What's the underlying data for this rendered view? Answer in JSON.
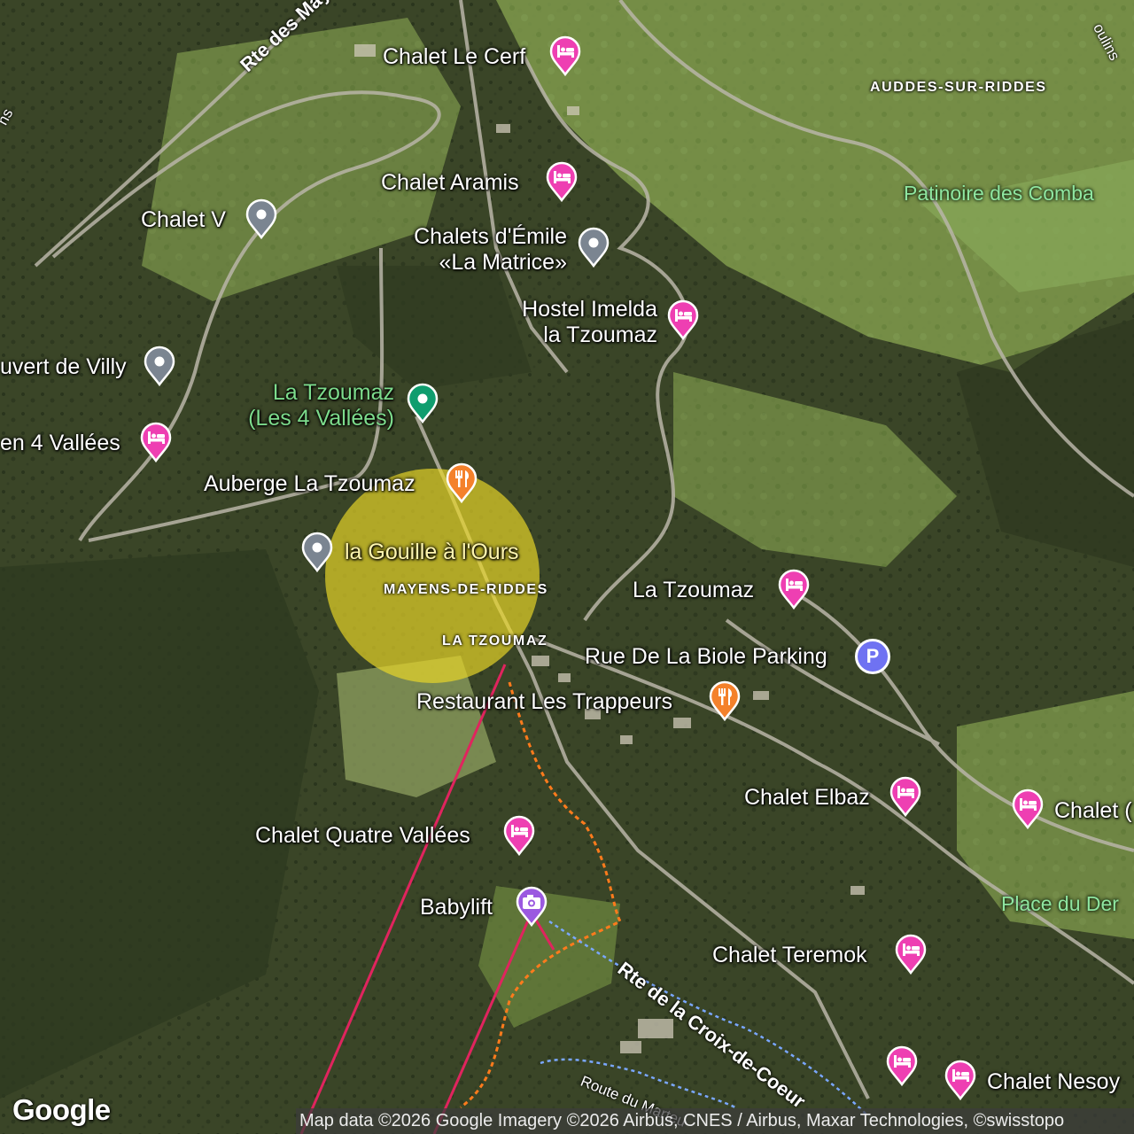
{
  "map": {
    "area_labels": [
      "AUDDES-SUR-RIDDES",
      "MAYENS-DE-RIDDES",
      "LA TZOUMAZ"
    ],
    "poi_labels": [
      "Patinoire des Comba",
      "Place du Der"
    ],
    "roads": [
      "Rte des Maye",
      "Rte de la Croix-de-Coeur",
      "Route du Marteu",
      "oulins",
      "ns"
    ],
    "markers": [
      {
        "label": "Chalet Le Cerf",
        "type": "lodging",
        "icon": "bed-icon",
        "color": "#ee3fb2"
      },
      {
        "label": "Chalet Aramis",
        "type": "lodging",
        "icon": "bed-icon",
        "color": "#ee3fb2"
      },
      {
        "label": "Chalet V",
        "type": "generic",
        "icon": "location-pin-icon",
        "color": "#7b8591"
      },
      {
        "label": "Chalets d'Émile «La Matrice»",
        "line1": "Chalets d'Émile",
        "line2": "«La Matrice»",
        "type": "generic",
        "icon": "location-pin-icon",
        "color": "#7b8591"
      },
      {
        "label": "Hostel Imelda la Tzoumaz",
        "line1": "Hostel Imelda",
        "line2": "la Tzoumaz",
        "type": "lodging",
        "icon": "bed-icon",
        "color": "#ee3fb2"
      },
      {
        "label": "uvert de Villy",
        "type": "generic",
        "icon": "location-pin-icon",
        "color": "#7b8591"
      },
      {
        "label": "La Tzoumaz (Les 4 Vallées)",
        "line1": "La Tzoumaz",
        "line2": "(Les 4 Vallées)",
        "type": "landmark",
        "icon": "location-pin-icon",
        "color": "#0f9d6e"
      },
      {
        "label": "en 4 Vallées",
        "type": "lodging",
        "icon": "bed-icon",
        "color": "#ee3fb2"
      },
      {
        "label": "Auberge La Tzoumaz",
        "type": "restaurant",
        "icon": "fork-knife-icon",
        "color": "#f4812b"
      },
      {
        "label": "la Gouille à l'Ours",
        "type": "generic",
        "icon": "location-pin-icon",
        "color": "#7b8591"
      },
      {
        "label": "La Tzoumaz",
        "type": "lodging",
        "icon": "bed-icon",
        "color": "#ee3fb2"
      },
      {
        "label": "Rue De La Biole Parking",
        "type": "parking",
        "icon": "parking-icon",
        "color": "#6f72f2",
        "glyph": "P"
      },
      {
        "label": "Restaurant Les Trappeurs",
        "type": "restaurant",
        "icon": "fork-knife-icon",
        "color": "#f4812b"
      },
      {
        "label": "Chalet Elbaz",
        "type": "lodging",
        "icon": "bed-icon",
        "color": "#ee3fb2"
      },
      {
        "label": "Chalet (",
        "type": "lodging",
        "icon": "bed-icon",
        "color": "#ee3fb2"
      },
      {
        "label": "Chalet Quatre Vallées",
        "type": "lodging",
        "icon": "bed-icon",
        "color": "#ee3fb2"
      },
      {
        "label": "Babylift",
        "type": "attraction",
        "icon": "camera-icon",
        "color": "#9b59e0"
      },
      {
        "label": "Chalet Teremok",
        "type": "lodging",
        "icon": "bed-icon",
        "color": "#ee3fb2"
      },
      {
        "label": "",
        "type": "lodging",
        "icon": "bed-icon",
        "color": "#ee3fb2"
      },
      {
        "label": "Chalet Nesoy",
        "type": "lodging",
        "icon": "bed-icon",
        "color": "#ee3fb2"
      }
    ],
    "selection_color": "#ebd728"
  },
  "footer": {
    "logo": "Google",
    "attribution": "Map data ©2026 Google Imagery ©2026 Airbus, CNES / Airbus, Maxar Technologies, ©swisstopo"
  }
}
